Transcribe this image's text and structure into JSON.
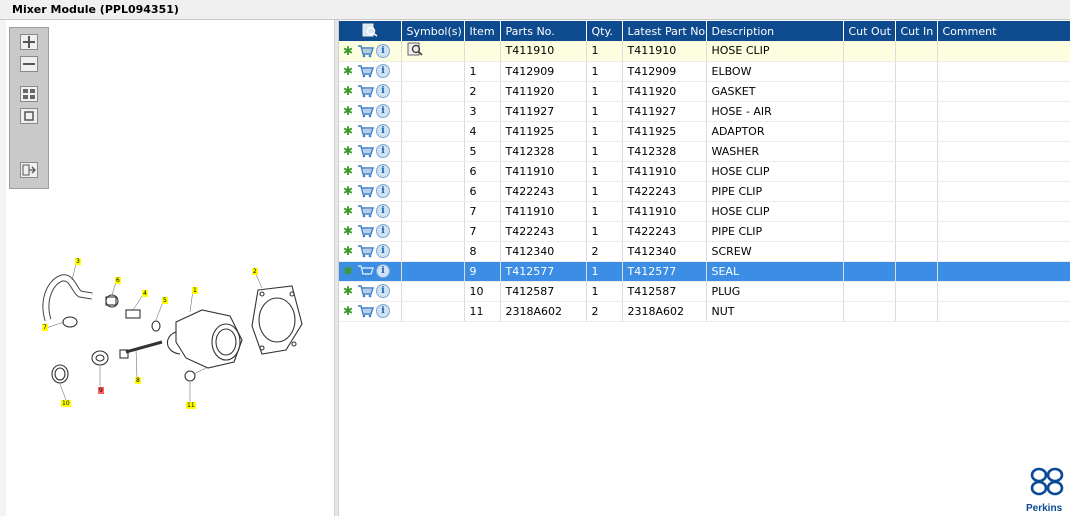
{
  "window": {
    "title": "Mixer Module (PPL094351)"
  },
  "toolbar": {
    "buttons": [
      {
        "name": "zoom-in-icon"
      },
      {
        "name": "zoom-out-icon"
      },
      {
        "name": "fit-grid-icon"
      },
      {
        "name": "fit-box-icon"
      },
      {
        "name": "export-icon"
      }
    ]
  },
  "diagram": {
    "callouts": [
      "3",
      "6",
      "4",
      "5",
      "1",
      "2",
      "7",
      "8",
      "9",
      "10",
      "11"
    ]
  },
  "table": {
    "headers": [
      "",
      "Symbol(s)",
      "Item",
      "Parts No.",
      "Qty.",
      "Latest Part No.",
      "Description",
      "Cut Out",
      "Cut In",
      "Comment"
    ],
    "rows": [
      {
        "item": "",
        "parts_no": "T411910",
        "qty": "1",
        "latest": "T411910",
        "desc": "HOSE CLIP",
        "cut_out": "",
        "cut_in": "",
        "comment": "",
        "symbol": true,
        "state": "highlight"
      },
      {
        "item": "1",
        "parts_no": "T412909",
        "qty": "1",
        "latest": "T412909",
        "desc": "ELBOW",
        "cut_out": "",
        "cut_in": "",
        "comment": "",
        "symbol": false,
        "state": ""
      },
      {
        "item": "2",
        "parts_no": "T411920",
        "qty": "1",
        "latest": "T411920",
        "desc": "GASKET",
        "cut_out": "",
        "cut_in": "",
        "comment": "",
        "symbol": false,
        "state": ""
      },
      {
        "item": "3",
        "parts_no": "T411927",
        "qty": "1",
        "latest": "T411927",
        "desc": "HOSE - AIR",
        "cut_out": "",
        "cut_in": "",
        "comment": "",
        "symbol": false,
        "state": ""
      },
      {
        "item": "4",
        "parts_no": "T411925",
        "qty": "1",
        "latest": "T411925",
        "desc": "ADAPTOR",
        "cut_out": "",
        "cut_in": "",
        "comment": "",
        "symbol": false,
        "state": ""
      },
      {
        "item": "5",
        "parts_no": "T412328",
        "qty": "1",
        "latest": "T412328",
        "desc": "WASHER",
        "cut_out": "",
        "cut_in": "",
        "comment": "",
        "symbol": false,
        "state": ""
      },
      {
        "item": "6",
        "parts_no": "T411910",
        "qty": "1",
        "latest": "T411910",
        "desc": "HOSE CLIP",
        "cut_out": "",
        "cut_in": "",
        "comment": "",
        "symbol": false,
        "state": ""
      },
      {
        "item": "6",
        "parts_no": "T422243",
        "qty": "1",
        "latest": "T422243",
        "desc": "PIPE CLIP",
        "cut_out": "",
        "cut_in": "",
        "comment": "",
        "symbol": false,
        "state": ""
      },
      {
        "item": "7",
        "parts_no": "T411910",
        "qty": "1",
        "latest": "T411910",
        "desc": "HOSE CLIP",
        "cut_out": "",
        "cut_in": "",
        "comment": "",
        "symbol": false,
        "state": ""
      },
      {
        "item": "7",
        "parts_no": "T422243",
        "qty": "1",
        "latest": "T422243",
        "desc": "PIPE CLIP",
        "cut_out": "",
        "cut_in": "",
        "comment": "",
        "symbol": false,
        "state": ""
      },
      {
        "item": "8",
        "parts_no": "T412340",
        "qty": "2",
        "latest": "T412340",
        "desc": "SCREW",
        "cut_out": "",
        "cut_in": "",
        "comment": "",
        "symbol": false,
        "state": ""
      },
      {
        "item": "9",
        "parts_no": "T412577",
        "qty": "1",
        "latest": "T412577",
        "desc": "SEAL",
        "cut_out": "",
        "cut_in": "",
        "comment": "",
        "symbol": false,
        "state": "selected"
      },
      {
        "item": "10",
        "parts_no": "T412587",
        "qty": "1",
        "latest": "T412587",
        "desc": "PLUG",
        "cut_out": "",
        "cut_in": "",
        "comment": "",
        "symbol": false,
        "state": ""
      },
      {
        "item": "11",
        "parts_no": "2318A602",
        "qty": "2",
        "latest": "2318A602",
        "desc": "NUT",
        "cut_out": "",
        "cut_in": "",
        "comment": "",
        "symbol": false,
        "state": ""
      }
    ]
  },
  "brand": {
    "name": "Perkins",
    "color": "#0a4a96"
  },
  "colors": {
    "header_bg": "#0d4a8e",
    "selected_row": "#3b8ee3",
    "highlight_row": "#fdfde0"
  }
}
